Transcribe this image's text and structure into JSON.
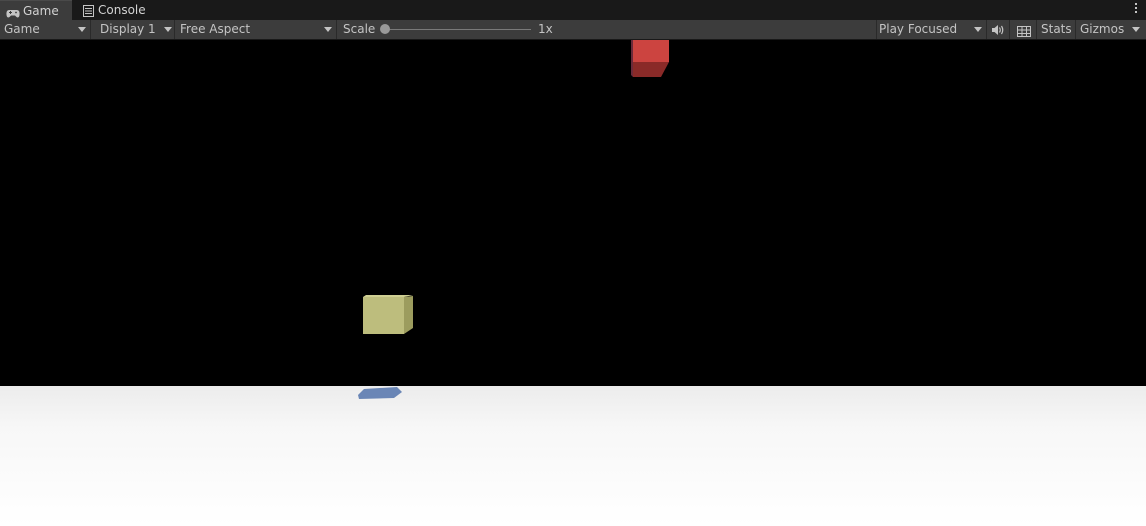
{
  "tabs": [
    {
      "label": "Game",
      "icon": "gamepad-icon",
      "active": true
    },
    {
      "label": "Console",
      "icon": "console-icon",
      "active": false
    }
  ],
  "toolbar": {
    "view_select": "Game",
    "display_select": "Display 1",
    "aspect_select": "Free Aspect",
    "scale_label": "Scale",
    "scale_value": "1x",
    "play_mode_select": "Play Focused",
    "audio_icon": "speaker-icon",
    "grid_icon": "grid-icon",
    "stats_label": "Stats",
    "gizmos_label": "Gizmos"
  },
  "scene": {
    "sky_color": "#000000",
    "ground_color": "#f5f5f5",
    "objects": [
      {
        "name": "red-cube",
        "color": "#c8403c"
      },
      {
        "name": "yellow-cube",
        "color": "#bcbc7c"
      },
      {
        "name": "blue-shadow",
        "color": "#6684b4"
      }
    ]
  }
}
